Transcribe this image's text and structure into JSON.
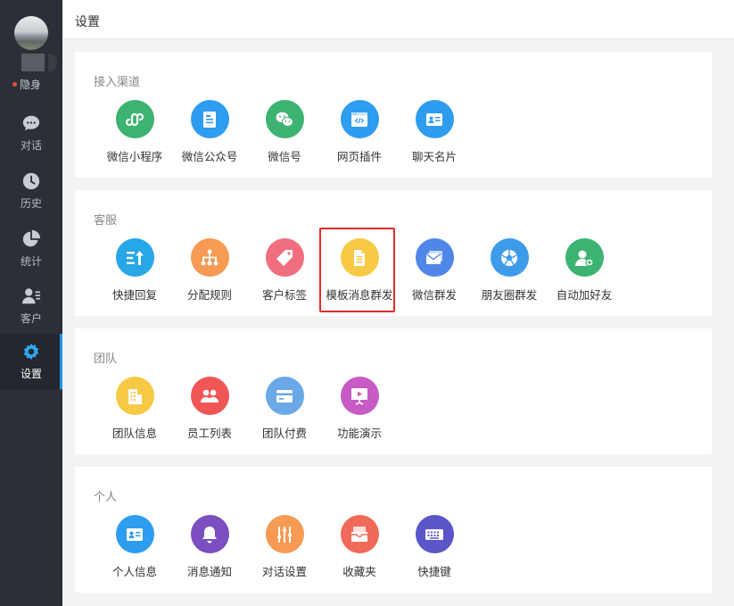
{
  "sidebar": {
    "status": "隐身",
    "status_color": "#e74c3c",
    "items": [
      {
        "label": "对话",
        "icon": "chat-icon"
      },
      {
        "label": "历史",
        "icon": "clock-icon"
      },
      {
        "label": "统计",
        "icon": "pie-chart-icon"
      },
      {
        "label": "客户",
        "icon": "customer-icon"
      },
      {
        "label": "设置",
        "icon": "gear-icon",
        "active": true
      }
    ]
  },
  "header": {
    "title": "设置"
  },
  "sections": [
    {
      "title": "接入渠道",
      "items": [
        {
          "label": "微信小程序",
          "icon": "mini-program-icon",
          "color": "#3cb371"
        },
        {
          "label": "微信公众号",
          "icon": "official-account-icon",
          "color": "#2e9df0"
        },
        {
          "label": "微信号",
          "icon": "wechat-icon",
          "color": "#3cb371"
        },
        {
          "label": "网页插件",
          "icon": "web-plugin-icon",
          "color": "#2e9df0"
        },
        {
          "label": "聊天名片",
          "icon": "business-card-icon",
          "color": "#2e9df0"
        }
      ]
    },
    {
      "title": "客服",
      "items": [
        {
          "label": "快捷回复",
          "icon": "quick-reply-icon",
          "color": "#27a7e6"
        },
        {
          "label": "分配规则",
          "icon": "org-chart-icon",
          "color": "#f79a53"
        },
        {
          "label": "客户标签",
          "icon": "tag-icon",
          "color": "#f06f7e"
        },
        {
          "label": "模板消息群发",
          "icon": "document-icon",
          "color": "#f7c944"
        },
        {
          "label": "微信群发",
          "icon": "mail-icon",
          "color": "#4f86e8"
        },
        {
          "label": "朋友圈群发",
          "icon": "aperture-icon",
          "color": "#3d9bea"
        },
        {
          "label": "自动加好友",
          "icon": "add-friend-icon",
          "color": "#3cb371"
        }
      ]
    },
    {
      "title": "团队",
      "items": [
        {
          "label": "团队信息",
          "icon": "building-icon",
          "color": "#f7c944"
        },
        {
          "label": "员工列表",
          "icon": "staff-icon",
          "color": "#f05656"
        },
        {
          "label": "团队付费",
          "icon": "credit-card-icon",
          "color": "#6aa8e8"
        },
        {
          "label": "功能演示",
          "icon": "presentation-icon",
          "color": "#c85ac4"
        }
      ]
    },
    {
      "title": "个人",
      "items": [
        {
          "label": "个人信息",
          "icon": "id-card-icon",
          "color": "#2e9df0"
        },
        {
          "label": "消息通知",
          "icon": "bell-icon",
          "color": "#7b4fbf"
        },
        {
          "label": "对话设置",
          "icon": "sliders-icon",
          "color": "#f79a53"
        },
        {
          "label": "收藏夹",
          "icon": "inbox-icon",
          "color": "#f06a5a"
        },
        {
          "label": "快捷键",
          "icon": "keyboard-icon",
          "color": "#5a55c9"
        }
      ]
    }
  ],
  "highlight": {
    "label": "模板消息群发"
  }
}
